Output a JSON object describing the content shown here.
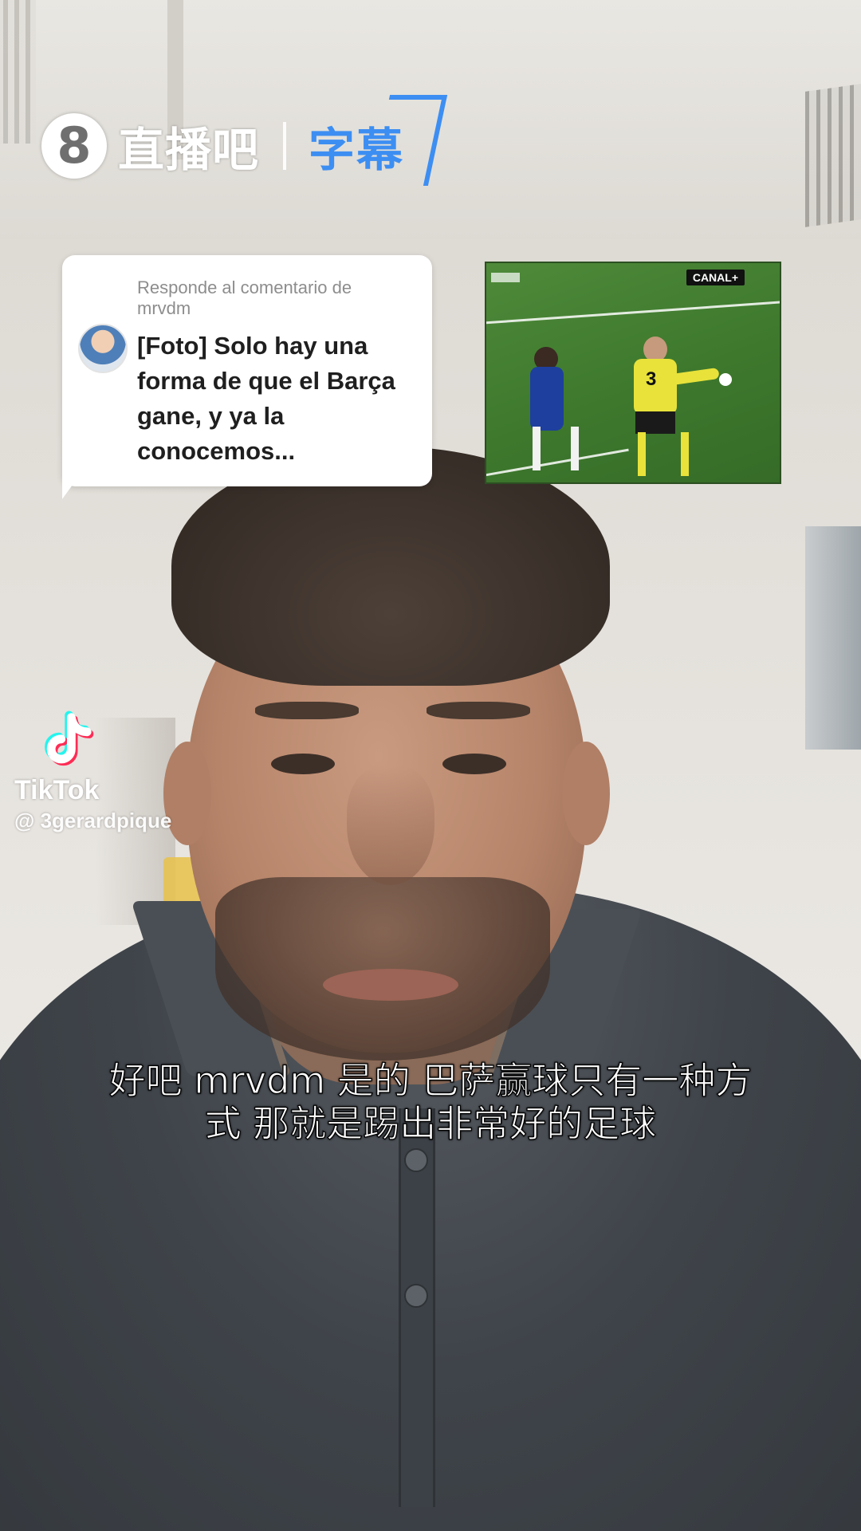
{
  "brand": {
    "badge": "8",
    "name": "直播吧",
    "sub": "字幕"
  },
  "comment": {
    "header": "Responde al comentario de mrvdm",
    "text": "[Foto] Solo hay una forma de que el Barça gane, y ya la conocemos..."
  },
  "clip": {
    "broadcaster": "CANAL+",
    "player_number": "3"
  },
  "tiktok": {
    "name": "TikTok",
    "handle": "@ 3gerardpique"
  },
  "subtitle": {
    "line1": "好吧 mrvdm 是的 巴萨赢球只有一种方",
    "line2": "式 那就是踢出非常好的足球"
  },
  "colors": {
    "brand_accent": "#3d8ef2",
    "shirt": "#43484e",
    "subtitle_text": "#ffffff"
  },
  "icons": [
    "tiktok-logo-icon",
    "zhibo8-logo-icon"
  ]
}
